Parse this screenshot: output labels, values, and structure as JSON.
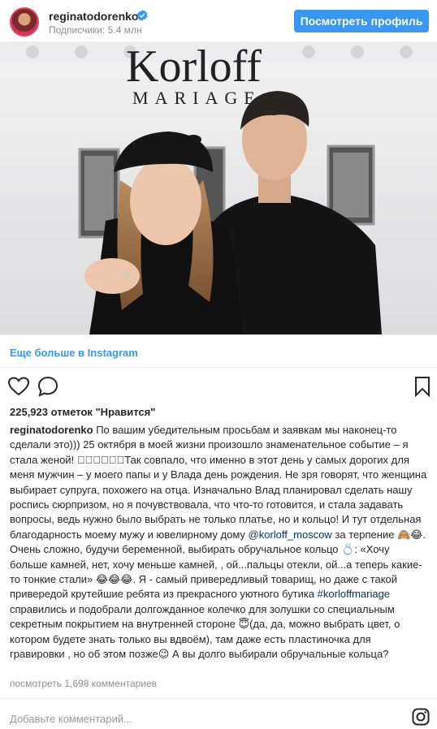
{
  "header": {
    "username": "reginatodorenko",
    "followers": "Подписчики: 5.4 млн",
    "view_profile": "Посмотреть профиль"
  },
  "photo": {
    "brand_line1": "Korloff",
    "brand_line2": "MARIAGE"
  },
  "more_link": "Еще больше в Instagram",
  "actions": {
    "icons": [
      "heart-icon",
      "comment-icon",
      "bookmark-icon"
    ]
  },
  "likes": "225,923 отметок \"Нравится\"",
  "caption": {
    "user": "reginatodorenko",
    "part1": " По вашим убедительным просьбам и заявкам мы наконец-то сделали это))) 25 октября в моей жизни произошло знаменательное событие – я стала женой! ⃞⃞⃞⃞⃞⃞Так совпало, что именно в этот день у самых дорогих для меня мужчин – у моего папы и у Влада день рождения. Не зря говорят, что женщина выбирает супруга, похожего на отца. Изначально Влад планировал сделать нашу роспись сюрпризом, но я почувствовала, что что-то готовится, и стала задавать вопросы, ведь нужно было выбрать не только платье, но и кольцо! И тут отдельная благодарность моему мужу и ювелирному дому ",
    "mention": "@korloff_moscow",
    "part2": " за терпение 🙈😂. Очень сложно, будучи беременной, выбирать обручальное кольцо 💍: «Хочу больше камней, нет, хочу меньше камней, , ой...пальцы отекли, ой...а теперь какие-то тонкие стали» 😂😂😂. Я - самый привередливый товарищ, но даже с такой привередой крутейшие ребята из прекрасного уютного бутика ",
    "hashtag": "#korloffmariage",
    "part3": " справились и подобрали долгожданное колечко для золушки со специальным секретным покрытием на внутренней стороне 😇(да, да, можно выбрать цвет, о котором будете знать только вы вдвоём), там даже есть пластиночка для гравировки , но об этом позже😉 А вы долго выбирали обручальные кольца?"
  },
  "comments_link": "посмотреть 1,698 комментариев",
  "comment_placeholder": "Добавьте комментарий...",
  "colors": {
    "accent": "#3897f0",
    "text": "#262626",
    "muted": "#8e8e8e",
    "mention": "#003569",
    "divider": "#efefef"
  }
}
